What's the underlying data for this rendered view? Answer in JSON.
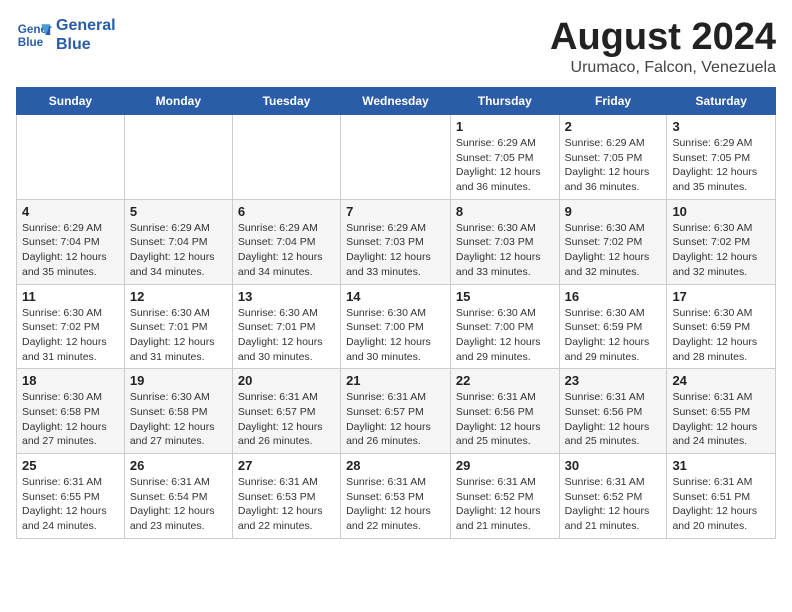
{
  "header": {
    "logo_line1": "General",
    "logo_line2": "Blue",
    "month_year": "August 2024",
    "location": "Urumaco, Falcon, Venezuela"
  },
  "days_of_week": [
    "Sunday",
    "Monday",
    "Tuesday",
    "Wednesday",
    "Thursday",
    "Friday",
    "Saturday"
  ],
  "weeks": [
    [
      {
        "day": "",
        "info": ""
      },
      {
        "day": "",
        "info": ""
      },
      {
        "day": "",
        "info": ""
      },
      {
        "day": "",
        "info": ""
      },
      {
        "day": "1",
        "info": "Sunrise: 6:29 AM\nSunset: 7:05 PM\nDaylight: 12 hours\nand 36 minutes."
      },
      {
        "day": "2",
        "info": "Sunrise: 6:29 AM\nSunset: 7:05 PM\nDaylight: 12 hours\nand 36 minutes."
      },
      {
        "day": "3",
        "info": "Sunrise: 6:29 AM\nSunset: 7:05 PM\nDaylight: 12 hours\nand 35 minutes."
      }
    ],
    [
      {
        "day": "4",
        "info": "Sunrise: 6:29 AM\nSunset: 7:04 PM\nDaylight: 12 hours\nand 35 minutes."
      },
      {
        "day": "5",
        "info": "Sunrise: 6:29 AM\nSunset: 7:04 PM\nDaylight: 12 hours\nand 34 minutes."
      },
      {
        "day": "6",
        "info": "Sunrise: 6:29 AM\nSunset: 7:04 PM\nDaylight: 12 hours\nand 34 minutes."
      },
      {
        "day": "7",
        "info": "Sunrise: 6:29 AM\nSunset: 7:03 PM\nDaylight: 12 hours\nand 33 minutes."
      },
      {
        "day": "8",
        "info": "Sunrise: 6:30 AM\nSunset: 7:03 PM\nDaylight: 12 hours\nand 33 minutes."
      },
      {
        "day": "9",
        "info": "Sunrise: 6:30 AM\nSunset: 7:02 PM\nDaylight: 12 hours\nand 32 minutes."
      },
      {
        "day": "10",
        "info": "Sunrise: 6:30 AM\nSunset: 7:02 PM\nDaylight: 12 hours\nand 32 minutes."
      }
    ],
    [
      {
        "day": "11",
        "info": "Sunrise: 6:30 AM\nSunset: 7:02 PM\nDaylight: 12 hours\nand 31 minutes."
      },
      {
        "day": "12",
        "info": "Sunrise: 6:30 AM\nSunset: 7:01 PM\nDaylight: 12 hours\nand 31 minutes."
      },
      {
        "day": "13",
        "info": "Sunrise: 6:30 AM\nSunset: 7:01 PM\nDaylight: 12 hours\nand 30 minutes."
      },
      {
        "day": "14",
        "info": "Sunrise: 6:30 AM\nSunset: 7:00 PM\nDaylight: 12 hours\nand 30 minutes."
      },
      {
        "day": "15",
        "info": "Sunrise: 6:30 AM\nSunset: 7:00 PM\nDaylight: 12 hours\nand 29 minutes."
      },
      {
        "day": "16",
        "info": "Sunrise: 6:30 AM\nSunset: 6:59 PM\nDaylight: 12 hours\nand 29 minutes."
      },
      {
        "day": "17",
        "info": "Sunrise: 6:30 AM\nSunset: 6:59 PM\nDaylight: 12 hours\nand 28 minutes."
      }
    ],
    [
      {
        "day": "18",
        "info": "Sunrise: 6:30 AM\nSunset: 6:58 PM\nDaylight: 12 hours\nand 27 minutes."
      },
      {
        "day": "19",
        "info": "Sunrise: 6:30 AM\nSunset: 6:58 PM\nDaylight: 12 hours\nand 27 minutes."
      },
      {
        "day": "20",
        "info": "Sunrise: 6:31 AM\nSunset: 6:57 PM\nDaylight: 12 hours\nand 26 minutes."
      },
      {
        "day": "21",
        "info": "Sunrise: 6:31 AM\nSunset: 6:57 PM\nDaylight: 12 hours\nand 26 minutes."
      },
      {
        "day": "22",
        "info": "Sunrise: 6:31 AM\nSunset: 6:56 PM\nDaylight: 12 hours\nand 25 minutes."
      },
      {
        "day": "23",
        "info": "Sunrise: 6:31 AM\nSunset: 6:56 PM\nDaylight: 12 hours\nand 25 minutes."
      },
      {
        "day": "24",
        "info": "Sunrise: 6:31 AM\nSunset: 6:55 PM\nDaylight: 12 hours\nand 24 minutes."
      }
    ],
    [
      {
        "day": "25",
        "info": "Sunrise: 6:31 AM\nSunset: 6:55 PM\nDaylight: 12 hours\nand 24 minutes."
      },
      {
        "day": "26",
        "info": "Sunrise: 6:31 AM\nSunset: 6:54 PM\nDaylight: 12 hours\nand 23 minutes."
      },
      {
        "day": "27",
        "info": "Sunrise: 6:31 AM\nSunset: 6:53 PM\nDaylight: 12 hours\nand 22 minutes."
      },
      {
        "day": "28",
        "info": "Sunrise: 6:31 AM\nSunset: 6:53 PM\nDaylight: 12 hours\nand 22 minutes."
      },
      {
        "day": "29",
        "info": "Sunrise: 6:31 AM\nSunset: 6:52 PM\nDaylight: 12 hours\nand 21 minutes."
      },
      {
        "day": "30",
        "info": "Sunrise: 6:31 AM\nSunset: 6:52 PM\nDaylight: 12 hours\nand 21 minutes."
      },
      {
        "day": "31",
        "info": "Sunrise: 6:31 AM\nSunset: 6:51 PM\nDaylight: 12 hours\nand 20 minutes."
      }
    ]
  ]
}
